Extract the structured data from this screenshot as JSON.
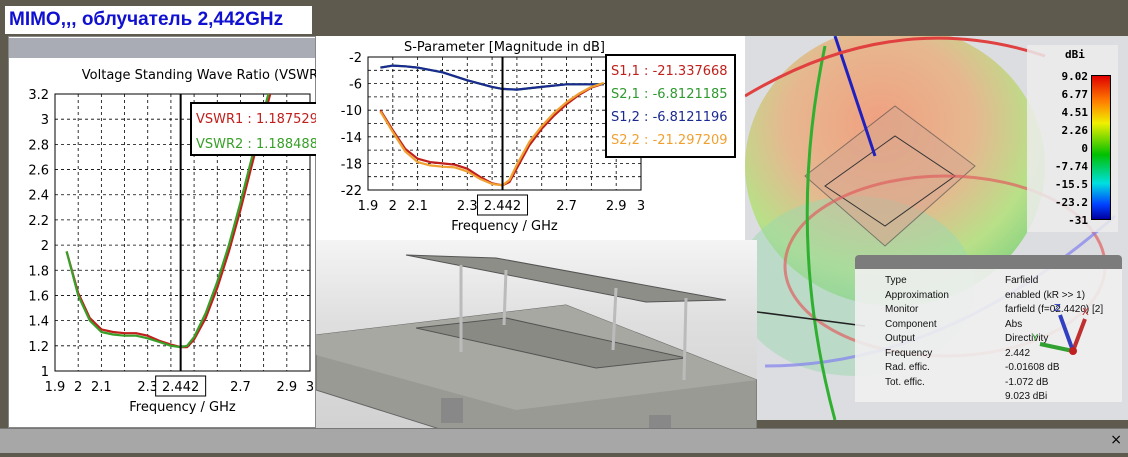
{
  "title": "MIMO,,, облучатель 2,442GHz",
  "colors": {
    "s11": "#c0201c",
    "s21": "#2f9a30",
    "s12": "#1a2a90",
    "s22": "#f0a030",
    "vswr1": "#c0201c",
    "vswr2": "#38a028"
  },
  "vswr": {
    "chart_data": {
      "type": "line",
      "title": "Voltage Standing Wave Ratio (VSWR)",
      "xlabel": "Frequency / GHz",
      "ylabel": "",
      "xlim": [
        1.9,
        3
      ],
      "ylim": [
        1,
        3.2
      ],
      "xticks": [
        "1.9",
        "2",
        "2.1",
        "2.3",
        "2.7",
        "2.9",
        "3"
      ],
      "yticks": [
        "3.2",
        "3",
        "2.8",
        "2.6",
        "2.4",
        "2.2",
        "2",
        "1.8",
        "1.6",
        "1.4",
        "1.2",
        "1"
      ],
      "marker": "2.442",
      "series": [
        {
          "name": "VSWR1",
          "x": [
            1.95,
            2.0,
            2.05,
            2.1,
            2.15,
            2.2,
            2.25,
            2.3,
            2.35,
            2.4,
            2.442,
            2.47,
            2.5,
            2.55,
            2.6,
            2.65,
            2.7,
            2.75,
            2.8,
            2.85
          ],
          "y": [
            1.95,
            1.62,
            1.42,
            1.33,
            1.31,
            1.3,
            1.3,
            1.28,
            1.24,
            1.21,
            1.19,
            1.19,
            1.25,
            1.42,
            1.66,
            1.95,
            2.28,
            2.64,
            3.0,
            3.35
          ]
        },
        {
          "name": "VSWR2",
          "x": [
            1.95,
            2.0,
            2.05,
            2.1,
            2.15,
            2.2,
            2.25,
            2.3,
            2.35,
            2.4,
            2.442,
            2.47,
            2.5,
            2.55,
            2.6,
            2.65,
            2.7,
            2.75,
            2.8,
            2.85
          ],
          "y": [
            1.95,
            1.6,
            1.4,
            1.31,
            1.29,
            1.28,
            1.28,
            1.26,
            1.23,
            1.2,
            1.19,
            1.2,
            1.27,
            1.46,
            1.71,
            2.0,
            2.34,
            2.7,
            3.06,
            3.4
          ]
        }
      ],
      "legend": [
        "VSWR1 : 1.187529",
        "VSWR2 : 1.188488"
      ]
    }
  },
  "sparam": {
    "chart_data": {
      "type": "line",
      "title": "S-Parameter [Magnitude in dB]",
      "xlabel": "Frequency / GHz",
      "xlim": [
        1.9,
        3
      ],
      "ylim": [
        -22,
        -2
      ],
      "xticks": [
        "1.9",
        "2",
        "2.1",
        "2.3",
        "2.7",
        "2.9",
        "3"
      ],
      "yticks": [
        "-2",
        "-6",
        "-10",
        "-14",
        "-18",
        "-22"
      ],
      "marker": "2.442",
      "series": [
        {
          "name": "S1,1",
          "x": [
            1.95,
            2.0,
            2.05,
            2.1,
            2.15,
            2.2,
            2.25,
            2.3,
            2.35,
            2.4,
            2.442,
            2.47,
            2.5,
            2.55,
            2.6,
            2.65,
            2.7,
            2.75,
            2.8,
            2.85
          ],
          "y": [
            -10,
            -13,
            -15.8,
            -17.3,
            -17.8,
            -18,
            -18.2,
            -18.8,
            -20,
            -21,
            -21.3,
            -20.8,
            -18.7,
            -15.3,
            -12.8,
            -10.8,
            -9.1,
            -7.7,
            -6.6,
            -6
          ]
        },
        {
          "name": "S2,1",
          "x": [
            1.95,
            2.0,
            2.05,
            2.1,
            2.2,
            2.3,
            2.4,
            2.442,
            2.5,
            2.6,
            2.7,
            2.8,
            2.85
          ],
          "y": [
            -3.6,
            -3.3,
            -3.4,
            -3.6,
            -4.3,
            -5.5,
            -6.5,
            -6.8,
            -6.9,
            -6.5,
            -6.1,
            -6.1,
            -6.1
          ]
        },
        {
          "name": "S1,2",
          "x": [
            1.95,
            2.0,
            2.05,
            2.1,
            2.2,
            2.3,
            2.4,
            2.442,
            2.5,
            2.6,
            2.7,
            2.8,
            2.85
          ],
          "y": [
            -3.6,
            -3.3,
            -3.4,
            -3.6,
            -4.3,
            -5.5,
            -6.5,
            -6.8,
            -6.9,
            -6.5,
            -6.1,
            -6.1,
            -6.1
          ]
        },
        {
          "name": "S2,2",
          "x": [
            1.95,
            2.0,
            2.05,
            2.1,
            2.15,
            2.2,
            2.25,
            2.3,
            2.35,
            2.4,
            2.442,
            2.47,
            2.5,
            2.55,
            2.6,
            2.65,
            2.7,
            2.75,
            2.8,
            2.85
          ],
          "y": [
            -10.2,
            -13.3,
            -16.2,
            -17.8,
            -18.3,
            -18.5,
            -18.6,
            -19.2,
            -20.3,
            -21.1,
            -21.3,
            -20.5,
            -18.2,
            -14.8,
            -12.4,
            -10.4,
            -8.8,
            -7.5,
            -6.5,
            -5.9
          ]
        }
      ],
      "legend": [
        "S1,1 : -21.337668",
        "S2,1 : -6.8121185",
        "S1,2 : -6.8121196",
        "S2,2 : -21.297209"
      ]
    }
  },
  "farfield": {
    "unit": "dBi",
    "scale": [
      "9.02",
      "6.77",
      "4.51",
      "2.26",
      "0",
      "-7.74",
      "-15.5",
      "-23.2",
      "-31"
    ],
    "info": [
      {
        "label": "Type",
        "value": "Farfield"
      },
      {
        "label": "Approximation",
        "value": "enabled (kR >> 1)"
      },
      {
        "label": "Monitor",
        "value": "farfield (f=02.4420) [2]"
      },
      {
        "label": "Component",
        "value": "Abs"
      },
      {
        "label": "Output",
        "value": "Directivity"
      },
      {
        "label": "Frequency",
        "value": "2.442"
      },
      {
        "label": "Rad. effic.",
        "value": "-0.01608 dB"
      },
      {
        "label": "Tot. effic.",
        "value": "-1.072 dB"
      },
      {
        "label": "",
        "value": "9.023 dBi"
      }
    ],
    "axes": [
      "X",
      "Y",
      "Z"
    ]
  },
  "close_label": "×"
}
